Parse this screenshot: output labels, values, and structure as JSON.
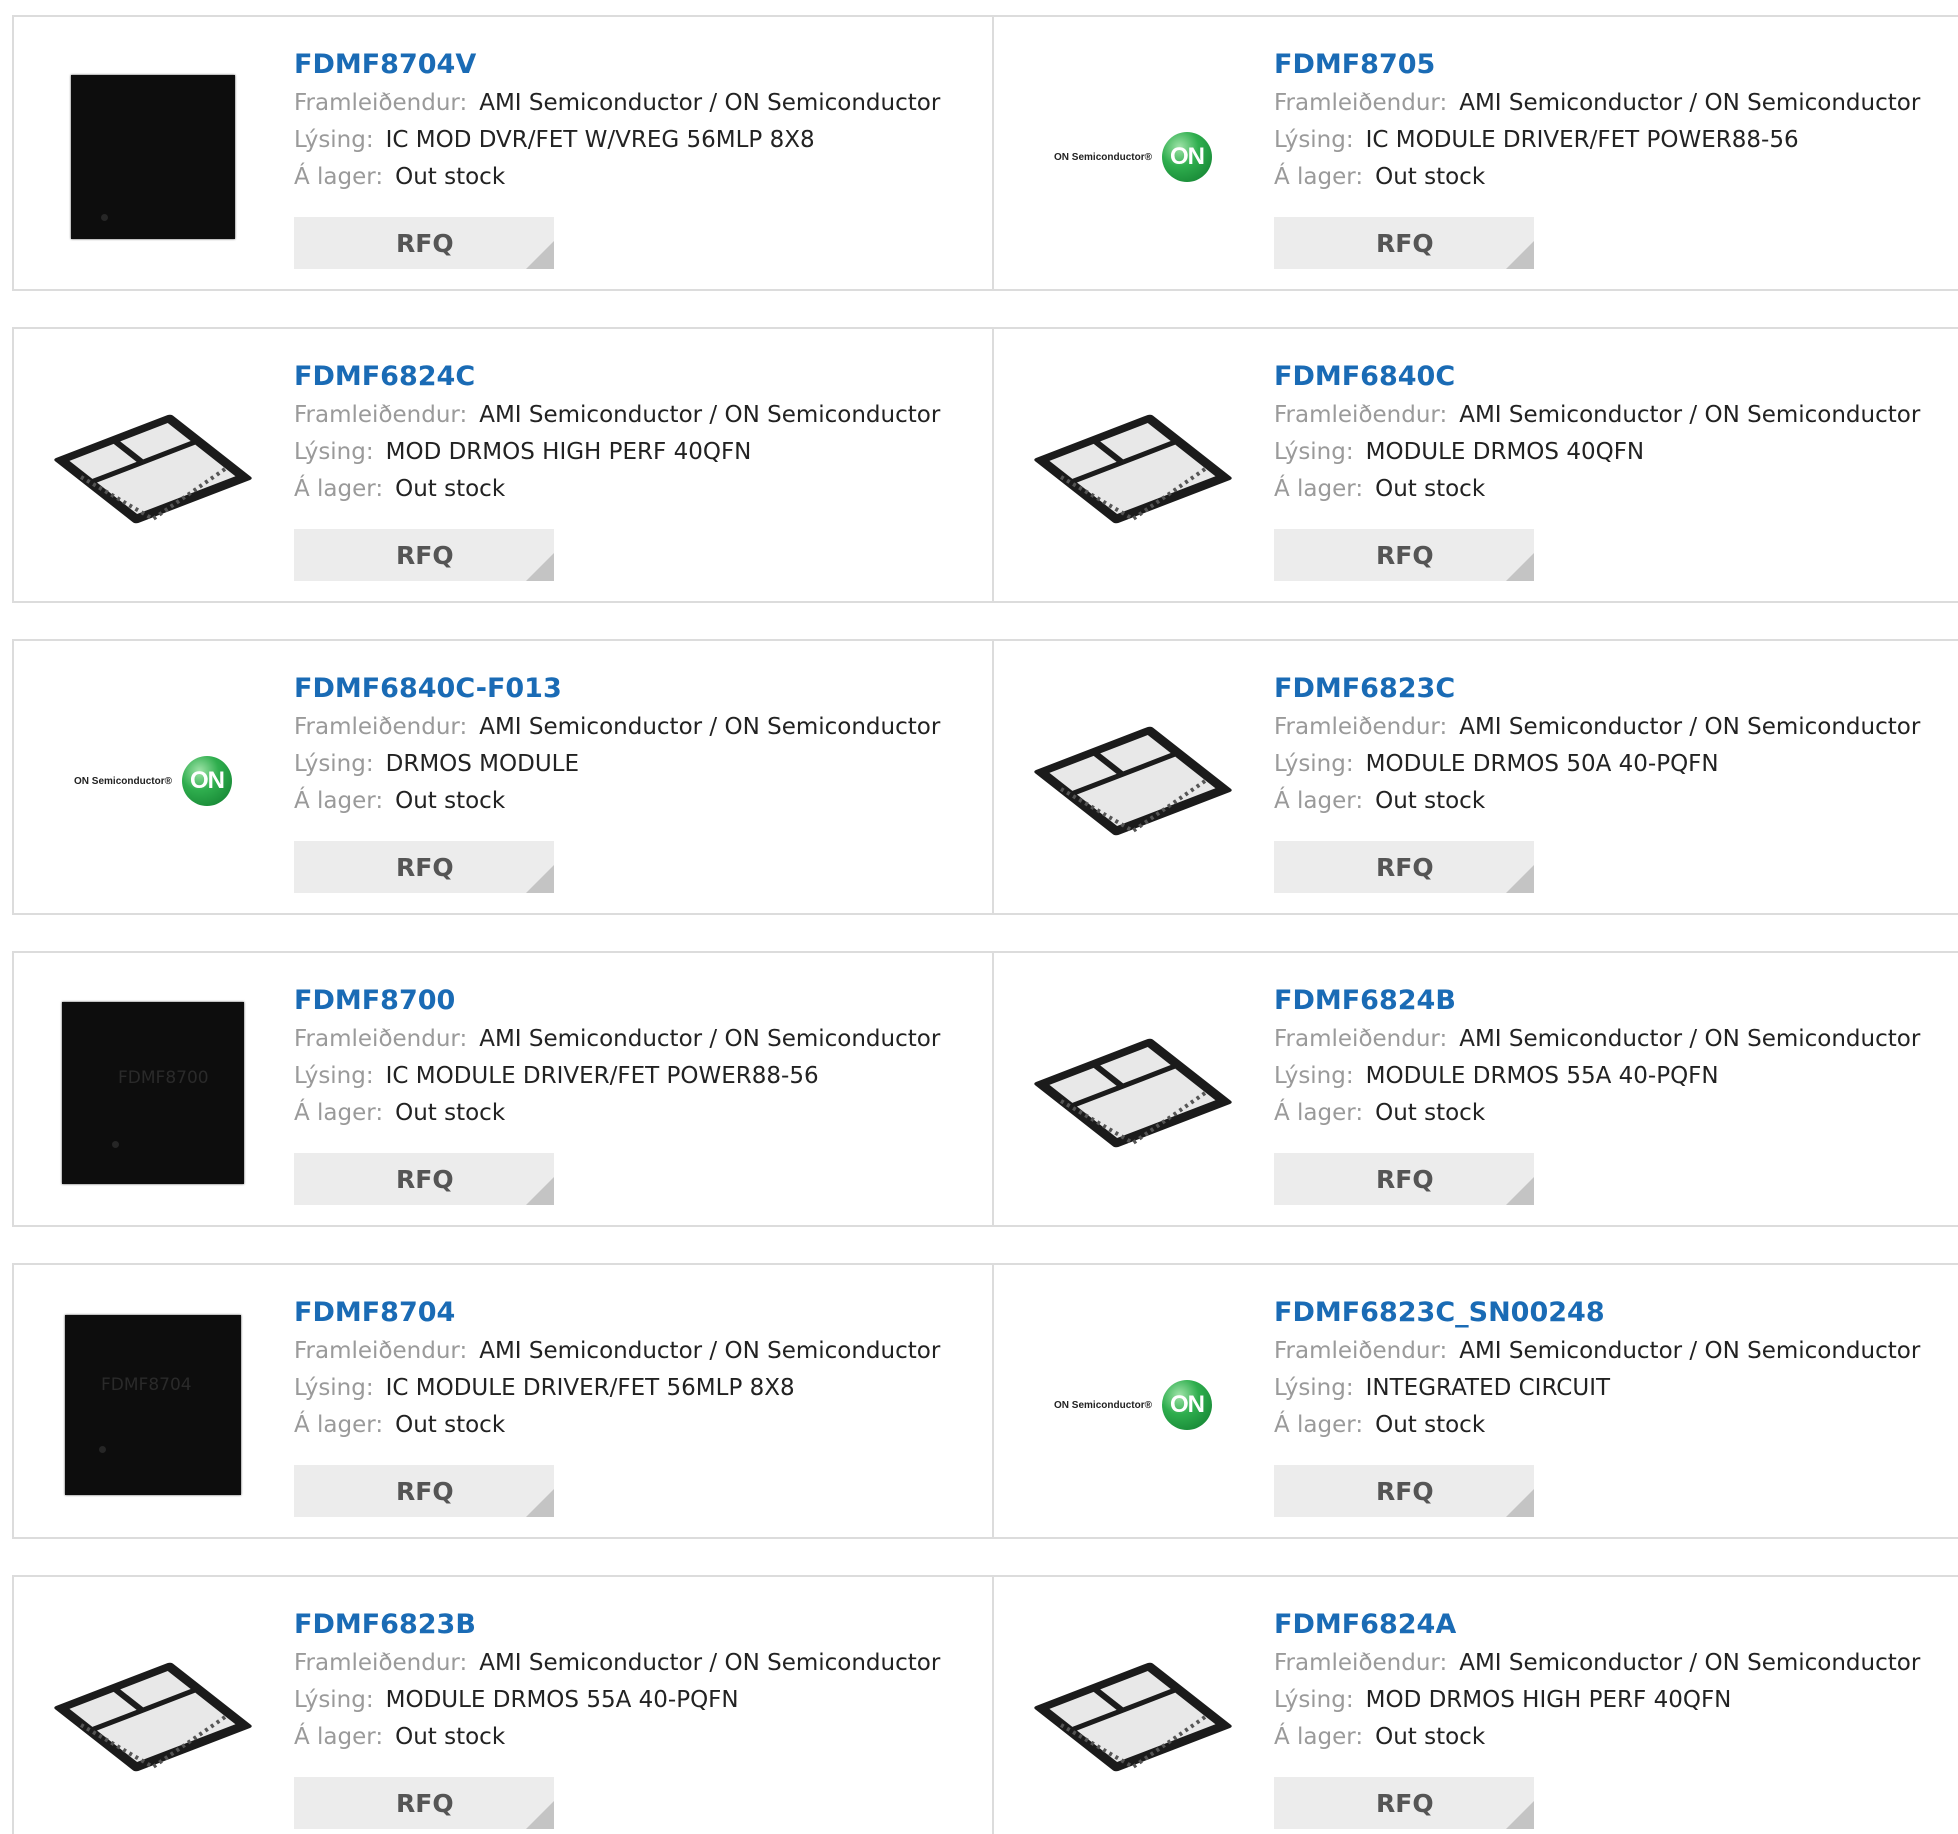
{
  "labels": {
    "manufacturer": "Framleiðendur:",
    "description": "Lýsing:",
    "stock": "Á lager:",
    "rfq": "RFQ"
  },
  "colors": {
    "link": "#1a6bb5",
    "label_gray": "#9a9a9a",
    "button_bg": "#ececec",
    "on_green": "#2fae4e"
  },
  "products": [
    {
      "part": "FDMF8704V",
      "manufacturer": "AMI Semiconductor / ON Semiconductor",
      "description": "IC MOD DVR/FET W/VREG 56MLP 8X8",
      "stock": "Out stock",
      "image": "dark-chip-icon"
    },
    {
      "part": "FDMF8705",
      "manufacturer": "AMI Semiconductor / ON Semiconductor",
      "description": "IC MODULE DRIVER/FET POWER88-56",
      "stock": "Out stock",
      "image": "on-semiconductor-logo",
      "logo_text": "ON Semiconductor®",
      "logo_ball": "ON"
    },
    {
      "part": "FDMF6824C",
      "manufacturer": "AMI Semiconductor / ON Semiconductor",
      "description": "MOD DRMOS HIGH PERF 40QFN",
      "stock": "Out stock",
      "image": "qfn-chip-icon"
    },
    {
      "part": "FDMF6840C",
      "manufacturer": "AMI Semiconductor / ON Semiconductor",
      "description": "MODULE DRMOS 40QFN",
      "stock": "Out stock",
      "image": "qfn-chip-icon"
    },
    {
      "part": "FDMF6840C-F013",
      "manufacturer": "AMI Semiconductor / ON Semiconductor",
      "description": "DRMOS MODULE",
      "stock": "Out stock",
      "image": "on-semiconductor-logo",
      "logo_text": "ON Semiconductor®",
      "logo_ball": "ON"
    },
    {
      "part": "FDMF6823C",
      "manufacturer": "AMI Semiconductor / ON Semiconductor",
      "description": "MODULE DRMOS 50A 40-PQFN",
      "stock": "Out stock",
      "image": "qfn-chip-icon"
    },
    {
      "part": "FDMF8700",
      "manufacturer": "AMI Semiconductor / ON Semiconductor",
      "description": "IC MODULE DRIVER/FET POWER88-56",
      "stock": "Out stock",
      "image": "dark-chip-icon",
      "chip_marking": "FDMF8700"
    },
    {
      "part": "FDMF6824B",
      "manufacturer": "AMI Semiconductor / ON Semiconductor",
      "description": "MODULE DRMOS 55A 40-PQFN",
      "stock": "Out stock",
      "image": "qfn-chip-icon"
    },
    {
      "part": "FDMF8704",
      "manufacturer": "AMI Semiconductor / ON Semiconductor",
      "description": "IC MODULE DRIVER/FET 56MLP 8X8",
      "stock": "Out stock",
      "image": "dark-chip-icon",
      "chip_marking": "FDMF8704"
    },
    {
      "part": "FDMF6823C_SN00248",
      "manufacturer": "AMI Semiconductor / ON Semiconductor",
      "description": "INTEGRATED CIRCUIT",
      "stock": "Out stock",
      "image": "on-semiconductor-logo",
      "logo_text": "ON Semiconductor®",
      "logo_ball": "ON"
    },
    {
      "part": "FDMF6823B",
      "manufacturer": "AMI Semiconductor / ON Semiconductor",
      "description": "MODULE DRMOS 55A 40-PQFN",
      "stock": "Out stock",
      "image": "qfn-chip-icon"
    },
    {
      "part": "FDMF6824A",
      "manufacturer": "AMI Semiconductor / ON Semiconductor",
      "description": "MOD DRMOS HIGH PERF 40QFN",
      "stock": "Out stock",
      "image": "qfn-chip-icon"
    }
  ]
}
